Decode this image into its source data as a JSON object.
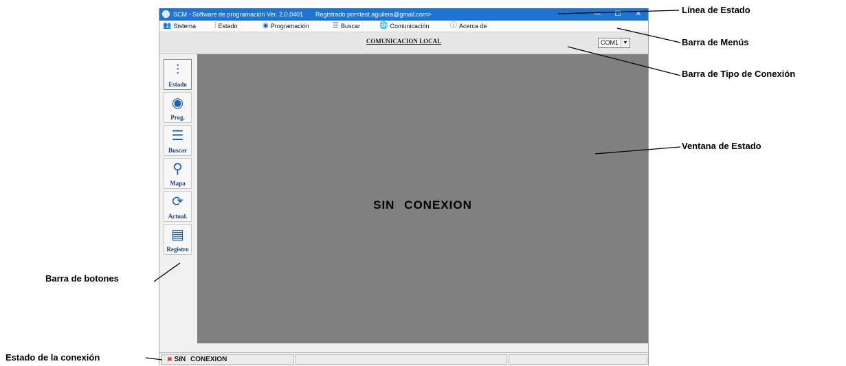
{
  "titlebar": {
    "title": "SCM - Software de programación Ver. 2.0.0401",
    "registered_label": "Registrado por:",
    "registered_email": "<test.aguilera@gmail.com>",
    "minimize": "—",
    "maximize": "☐",
    "close": "✕"
  },
  "menu": [
    {
      "label": "Sistema",
      "icon": "users-icon"
    },
    {
      "label": "Estado",
      "icon": "sliders-icon"
    },
    {
      "label": "Programación",
      "icon": "program-icon"
    },
    {
      "label": "Buscar",
      "icon": "list-icon"
    },
    {
      "label": "Comunicación",
      "icon": "network-icon"
    },
    {
      "label": "Acerca de",
      "icon": "info-icon"
    }
  ],
  "connection": {
    "label": "COMUNICACION LOCAL",
    "port_value": "COM1"
  },
  "sidebar": [
    {
      "label": "Estado",
      "icon": "sliders-icon",
      "active": true
    },
    {
      "label": "Prog.",
      "icon": "program-icon"
    },
    {
      "label": "Buscar",
      "icon": "list-icon"
    },
    {
      "label": "Mapa",
      "icon": "map-pin-icon"
    },
    {
      "label": "Actual.",
      "icon": "update-icon"
    },
    {
      "label": "Registro",
      "icon": "log-icon"
    }
  ],
  "status_window": {
    "message": "SIN CONEXION"
  },
  "statusbar": {
    "connection_state": "SIN CONEXION"
  },
  "annotations": {
    "linea_estado": "Línea de Estado",
    "barra_menus": "Barra de Menús",
    "barra_tipo_conexion": "Barra de Tipo de Conexión",
    "ventana_estado": "Ventana de Estado",
    "barra_botones": "Barra de botones",
    "estado_conexion": "Estado de la conexión"
  },
  "colors": {
    "titlebar": "#1e74d2",
    "status_pane": "#808080"
  }
}
